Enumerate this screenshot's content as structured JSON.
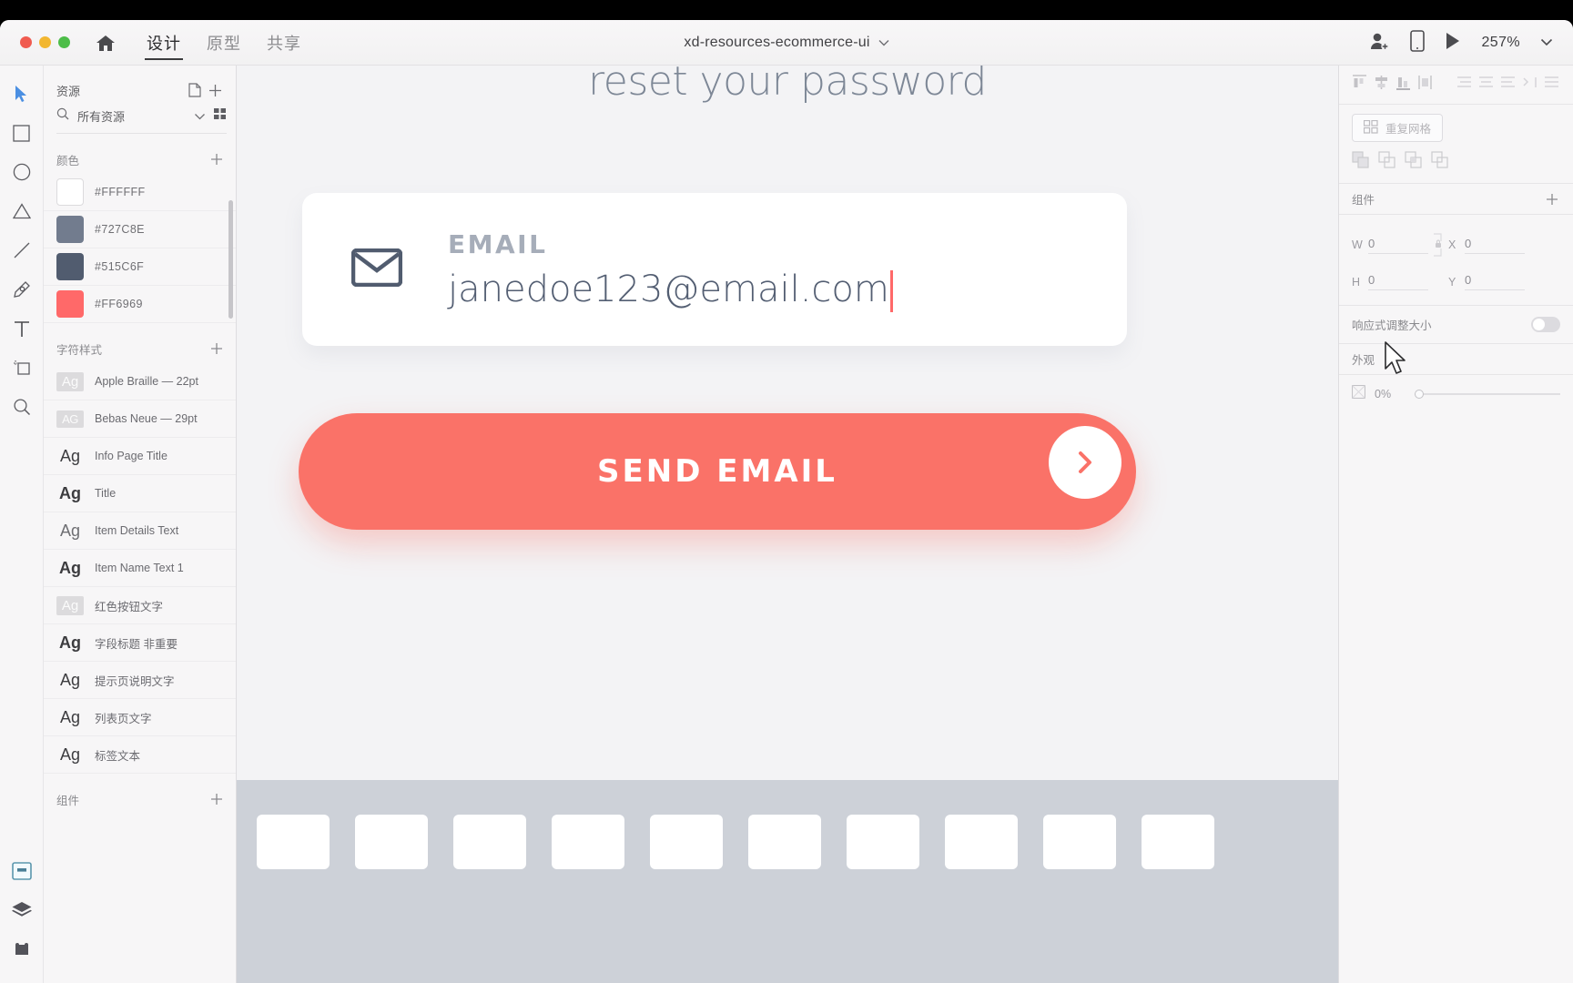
{
  "titlebar": {
    "home_icon": "home-icon",
    "tabs": [
      {
        "label": "设计",
        "active": true
      },
      {
        "label": "原型",
        "active": false
      },
      {
        "label": "共享",
        "active": false
      }
    ],
    "document_title": "xd-resources-ecommerce-ui",
    "document_chevron": "chevron-down-icon",
    "invite_icon": "add-user-icon",
    "device_preview_icon": "mobile-device-icon",
    "play_icon": "play-triangle-icon",
    "zoom_level": "257%",
    "zoom_chevron": "chevron-down-icon"
  },
  "toolbar": {
    "tools": [
      {
        "name": "select-tool",
        "icon": "cursor-arrow-icon",
        "active": true
      },
      {
        "name": "rectangle-tool",
        "icon": "rectangle-icon",
        "active": false
      },
      {
        "name": "ellipse-tool",
        "icon": "circle-icon",
        "active": false
      },
      {
        "name": "polygon-tool",
        "icon": "triangle-icon",
        "active": false
      },
      {
        "name": "line-tool",
        "icon": "line-icon",
        "active": false
      },
      {
        "name": "pen-tool",
        "icon": "pen-icon",
        "active": false
      },
      {
        "name": "text-tool",
        "icon": "text-t-icon",
        "active": false
      },
      {
        "name": "artboard-tool",
        "icon": "artboard-icon",
        "active": false
      },
      {
        "name": "zoom-tool",
        "icon": "magnifier-icon",
        "active": false
      }
    ],
    "panels": [
      {
        "name": "assets-panel-button",
        "icon": "assets-icon",
        "active": true
      },
      {
        "name": "layers-panel-button",
        "icon": "layers-icon",
        "active": false
      },
      {
        "name": "plugins-panel-button",
        "icon": "plugins-icon",
        "active": false
      }
    ]
  },
  "assets": {
    "header_label": "资源",
    "header_doc_icon": "document-icon",
    "header_add_icon": "plus-icon",
    "search_icon": "search-icon",
    "search_value": "所有资源",
    "search_chevron": "chevron-down-icon",
    "grid_view_icon": "grid-view-icon",
    "colors_section": {
      "label": "颜色",
      "add_icon": "plus-icon",
      "items": [
        {
          "hex": "#FFFFFF",
          "swatch": "#FFFFFF"
        },
        {
          "hex": "#727C8E",
          "swatch": "#727C8E"
        },
        {
          "hex": "#515C6F",
          "swatch": "#515C6F"
        },
        {
          "hex": "#FF6969",
          "swatch": "#FF6969"
        }
      ]
    },
    "character_styles_section": {
      "label": "字符样式",
      "add_icon": "plus-icon",
      "items": [
        {
          "preview": "Ag",
          "name": "Apple Braille — 22pt",
          "style": "chip"
        },
        {
          "preview": "AG",
          "name": "Bebas Neue — 29pt",
          "style": "chip-sm"
        },
        {
          "preview": "Ag",
          "name": "Info Page Title",
          "style": "plain"
        },
        {
          "preview": "Ag",
          "name": "Title",
          "style": "bold"
        },
        {
          "preview": "Ag",
          "name": "Item Details Text",
          "style": "thin"
        },
        {
          "preview": "Ag",
          "name": "Item Name Text 1",
          "style": "bold"
        },
        {
          "preview": "Ag",
          "name": "红色按钮文字",
          "style": "chip"
        },
        {
          "preview": "Ag",
          "name": "字段标题 非重要",
          "style": "bold"
        },
        {
          "preview": "Ag",
          "name": "提示页说明文字",
          "style": "plain"
        },
        {
          "preview": "Ag",
          "name": "列表页文字",
          "style": "plain"
        },
        {
          "preview": "Ag",
          "name": "标签文本",
          "style": "plain"
        }
      ]
    },
    "components_section": {
      "label": "组件",
      "add_icon": "plus-icon"
    }
  },
  "canvas": {
    "headline": "reset your password",
    "email_field": {
      "mail_icon": "envelope-icon",
      "label": "EMAIL",
      "value": "janedoe123@email.com",
      "caret_color": "#FF6969"
    },
    "cta": {
      "label": "SEND EMAIL",
      "background": "#FA7268",
      "arrow_icon": "chevron-right-icon"
    },
    "footer_cards_count": 10
  },
  "properties": {
    "align_icons": [
      "align-left-icon",
      "align-center-horizontal-icon",
      "align-right-icon",
      "align-top-icon"
    ],
    "distribute_icons": [
      "distribute-horizontal-icon",
      "distribute-vertical-icon",
      "distribute-spacing-icon",
      "distribute-edges-icon",
      "distribute-list-icon"
    ],
    "repeat_grid": {
      "label": "重复网格",
      "icon": "repeat-grid-icon"
    },
    "boolean_icons": [
      "boolean-add-icon",
      "boolean-subtract-icon",
      "boolean-intersect-icon",
      "boolean-exclude-icon"
    ],
    "components": {
      "label": "组件",
      "add_icon": "plus-icon"
    },
    "transform": {
      "w_label": "W",
      "w_value": "0",
      "h_label": "H",
      "h_value": "0",
      "x_label": "X",
      "x_value": "0",
      "y_label": "Y",
      "y_value": "0",
      "lock_icon": "lock-aspect-ratio-icon"
    },
    "responsive_resize": {
      "label": "响应式调整大小",
      "enabled": false
    },
    "appearance": {
      "label": "外观"
    },
    "opacity": {
      "icon": "opacity-icon",
      "value": "0%",
      "percent": 0
    }
  }
}
